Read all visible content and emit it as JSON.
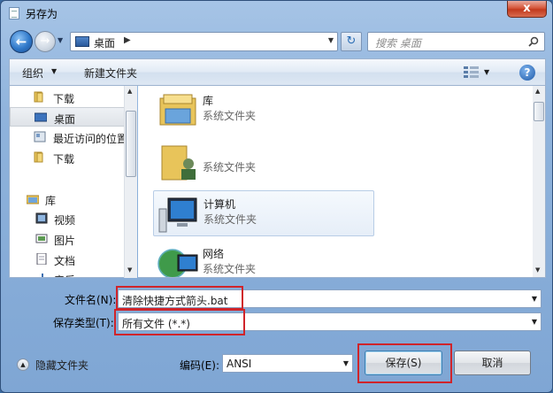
{
  "window": {
    "title": "另存为",
    "close_label": "x"
  },
  "address": {
    "location": "桌面",
    "search_placeholder": "搜索 桌面"
  },
  "toolbar": {
    "organize": "组织",
    "new_folder": "新建文件夹",
    "help": "?"
  },
  "nav_pane": {
    "items": [
      {
        "label": "下载",
        "icon": "folder-icon"
      },
      {
        "label": "桌面",
        "icon": "desktop-icon",
        "selected": true
      },
      {
        "label": "最近访问的位置",
        "icon": "recent-places-icon"
      },
      {
        "label": "下载",
        "icon": "folder-icon"
      },
      {
        "label": "库",
        "icon": "library-icon"
      },
      {
        "label": "视频",
        "icon": "video-icon"
      },
      {
        "label": "图片",
        "icon": "pictures-icon"
      },
      {
        "label": "文档",
        "icon": "documents-icon"
      },
      {
        "label": "音乐",
        "icon": "music-icon"
      }
    ]
  },
  "files": [
    {
      "name": "库",
      "desc": "系统文件夹",
      "icon": "library-folder-icon"
    },
    {
      "name": "",
      "desc": "系统文件夹",
      "icon": "user-folder-icon"
    },
    {
      "name": "计算机",
      "desc": "系统文件夹",
      "icon": "computer-icon",
      "hover": true
    },
    {
      "name": "网络",
      "desc": "系统文件夹",
      "icon": "network-icon"
    }
  ],
  "form": {
    "filename_label": "文件名(N):",
    "filename_value": "清除快捷方式箭头.bat",
    "filetype_label": "保存类型(T):",
    "filetype_value": "所有文件  (*.*)",
    "encoding_label": "编码(E):",
    "encoding_value": "ANSI",
    "hide_folders": "隐藏文件夹",
    "save": "保存(S)",
    "cancel": "取消"
  },
  "colors": {
    "highlight": "#d0242a",
    "accent": "#3c7fb1"
  }
}
